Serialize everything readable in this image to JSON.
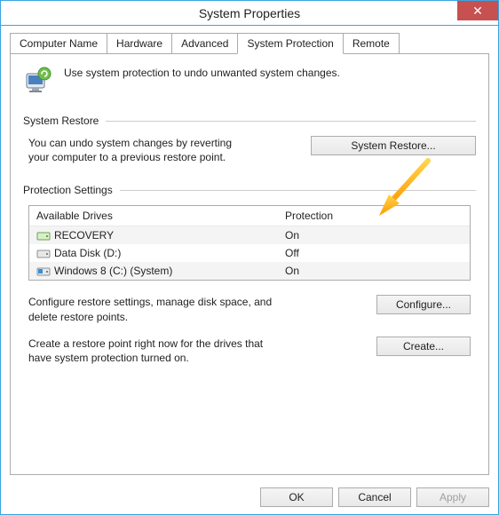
{
  "window": {
    "title": "System Properties"
  },
  "tabs": {
    "items": [
      {
        "label": "Computer Name"
      },
      {
        "label": "Hardware"
      },
      {
        "label": "Advanced"
      },
      {
        "label": "System Protection"
      },
      {
        "label": "Remote"
      }
    ],
    "activeIndex": 3
  },
  "intro": {
    "text": "Use system protection to undo unwanted system changes."
  },
  "systemRestore": {
    "heading": "System Restore",
    "text": "You can undo system changes by reverting your computer to a previous restore point.",
    "button": "System Restore..."
  },
  "protectionSettings": {
    "heading": "Protection Settings",
    "columns": {
      "drive": "Available Drives",
      "protection": "Protection"
    },
    "drives": [
      {
        "name": "RECOVERY",
        "protection": "On",
        "iconType": "drive-green"
      },
      {
        "name": "Data Disk (D:)",
        "protection": "Off",
        "iconType": "drive"
      },
      {
        "name": "Windows 8 (C:) (System)",
        "protection": "On",
        "iconType": "drive-win"
      }
    ],
    "configure": {
      "text": "Configure restore settings, manage disk space, and delete restore points.",
      "button": "Configure..."
    },
    "create": {
      "text": "Create a restore point right now for the drives that have system protection turned on.",
      "button": "Create..."
    }
  },
  "dialogButtons": {
    "ok": "OK",
    "cancel": "Cancel",
    "apply": "Apply"
  }
}
